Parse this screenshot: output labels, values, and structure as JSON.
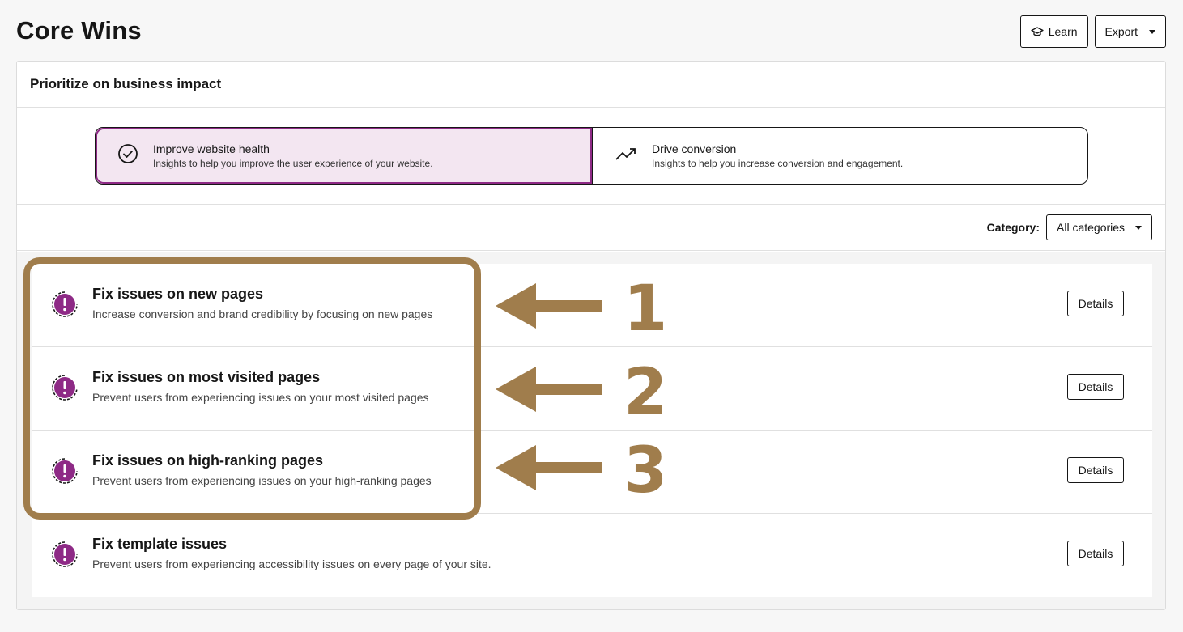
{
  "page_title": "Core Wins",
  "header": {
    "learn_label": "Learn",
    "export_label": "Export"
  },
  "card": {
    "title": "Prioritize on business impact",
    "segments": [
      {
        "title": "Improve website health",
        "desc": "Insights to help you improve the user experience of your website.",
        "icon": "check-circle-icon",
        "active": true
      },
      {
        "title": "Drive conversion",
        "desc": "Insights to help you increase conversion and engagement.",
        "icon": "trending-up-icon",
        "active": false
      }
    ],
    "filter": {
      "label": "Category:",
      "value": "All categories"
    }
  },
  "items": [
    {
      "title": "Fix issues on new pages",
      "desc": "Increase conversion and brand credibility by focusing on new pages",
      "button": "Details"
    },
    {
      "title": "Fix issues on most visited pages",
      "desc": "Prevent users from experiencing issues on your most visited pages",
      "button": "Details"
    },
    {
      "title": "Fix issues on high-ranking pages",
      "desc": "Prevent users from experiencing issues on your high-ranking pages",
      "button": "Details"
    },
    {
      "title": "Fix template issues",
      "desc": "Prevent users from experiencing accessibility issues on every page of your site.",
      "button": "Details"
    }
  ],
  "annotations": [
    "1",
    "2",
    "3"
  ],
  "colors": {
    "accent": "#8e2a86",
    "annotation": "#a07d4c",
    "active_bg": "#f3e6f1"
  }
}
